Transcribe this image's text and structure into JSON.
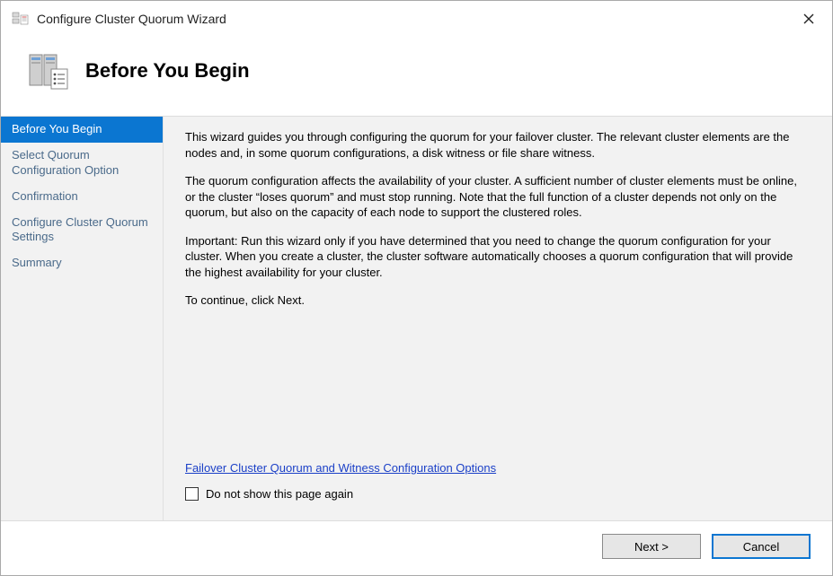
{
  "window": {
    "title": "Configure Cluster Quorum Wizard"
  },
  "header": {
    "title": "Before You Begin"
  },
  "sidebar": {
    "items": [
      {
        "label": "Before You Begin"
      },
      {
        "label": "Select Quorum Configuration Option"
      },
      {
        "label": "Confirmation"
      },
      {
        "label": "Configure Cluster Quorum Settings"
      },
      {
        "label": "Summary"
      }
    ]
  },
  "content": {
    "p1": "This wizard guides you through configuring the quorum for your failover cluster. The relevant cluster elements are the nodes and, in some quorum configurations, a disk witness or file share witness.",
    "p2": "The quorum configuration affects the availability of your cluster. A sufficient number of cluster elements must be online, or the cluster “loses quorum” and must stop running. Note that the full function of a cluster depends not only on the quorum, but also on the capacity of each node to support the clustered roles.",
    "p3": "Important: Run this wizard only if you have determined that you need to change the quorum configuration for your cluster. When you create a cluster, the cluster software automatically chooses a quorum configuration that will provide the highest availability for your cluster.",
    "p4": "To continue, click Next.",
    "link_label": "Failover Cluster Quorum and Witness Configuration Options",
    "checkbox_label": "Do not show this page again"
  },
  "buttons": {
    "next": "Next >",
    "cancel": "Cancel"
  }
}
